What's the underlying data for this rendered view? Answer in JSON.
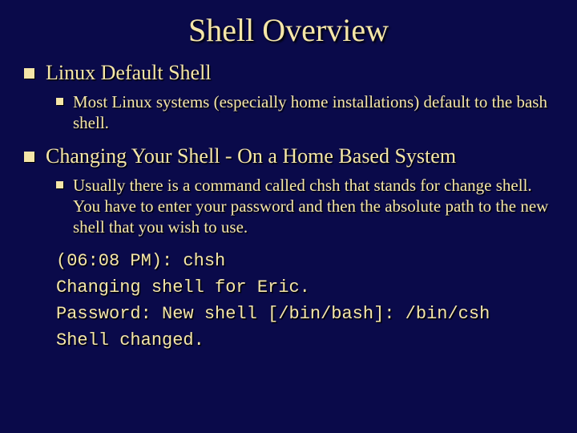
{
  "title": "Shell Overview",
  "section1": {
    "heading": "Linux Default Shell",
    "sub1": "Most Linux systems (especially home installations) default to the bash shell."
  },
  "section2": {
    "heading": "Changing Your Shell - On a Home Based System",
    "sub1": "Usually there is a command called chsh that stands for change shell. You have to enter your password and then the absolute path to the new shell that you wish to use."
  },
  "code": {
    "l1": "(06:08 PM): chsh",
    "l2": "Changing shell for Eric.",
    "l3": "Password: New shell [/bin/bash]: /bin/csh",
    "l4": "Shell changed."
  }
}
